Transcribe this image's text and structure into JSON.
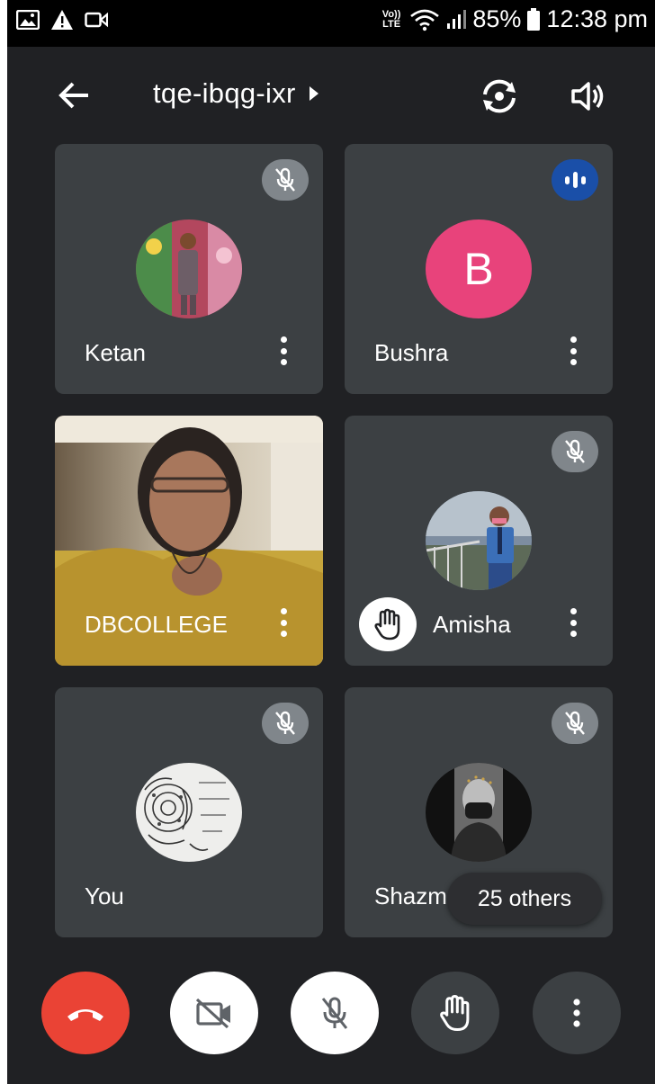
{
  "status_bar": {
    "volte": "Vo))",
    "lte": "LTE",
    "battery": "85%",
    "time": "12:38 pm"
  },
  "header": {
    "meeting_code": "tqe-ibqg-ixr",
    "back_icon": "arrow-back-icon",
    "switch_camera_icon": "switch-camera-icon",
    "speaker_icon": "speaker-icon"
  },
  "participants": [
    {
      "name": "Ketan",
      "state": "muted"
    },
    {
      "name": "Bushra",
      "initial": "B",
      "state": "speaking"
    },
    {
      "name": "DBCOLLEGE",
      "state": "video"
    },
    {
      "name": "Amisha",
      "state": "muted",
      "hand_raised": true
    },
    {
      "name": "You",
      "state": "muted"
    },
    {
      "name": "Shazm",
      "state": "muted"
    }
  ],
  "others": {
    "label": "25 others"
  },
  "controls": [
    {
      "name": "end-call",
      "icon": "phone-hangup-icon"
    },
    {
      "name": "camera-off",
      "icon": "videocam-off-icon"
    },
    {
      "name": "mic-off",
      "icon": "mic-off-icon"
    },
    {
      "name": "raise-hand",
      "icon": "hand-icon"
    },
    {
      "name": "more-options",
      "icon": "more-vert-icon"
    }
  ],
  "colors": {
    "background": "#202124",
    "tile": "#3c4043",
    "end_call": "#ea4335",
    "avatar_b": "#e8437b",
    "speaking": "#1a4fa8",
    "mute_badge": "#80868b"
  }
}
